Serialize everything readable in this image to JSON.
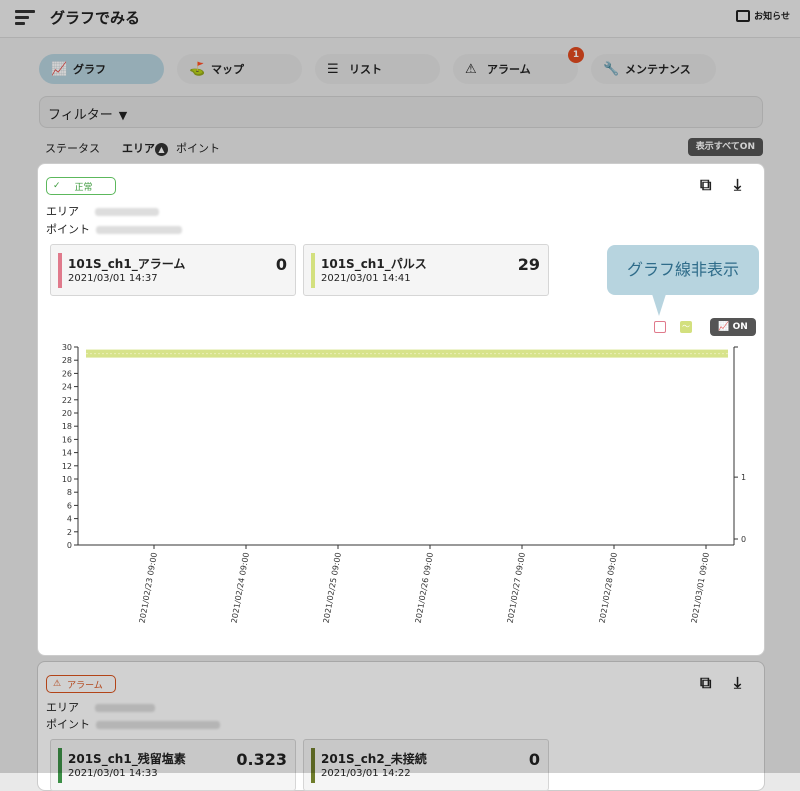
{
  "app": {
    "title": "グラフでみる",
    "notice": "お知らせ"
  },
  "tabs": [
    {
      "label": "グラフ",
      "icon": "chart-icon"
    },
    {
      "label": "マップ",
      "icon": "map-icon"
    },
    {
      "label": "リスト",
      "icon": "list-icon"
    },
    {
      "label": "アラーム",
      "icon": "warning-icon",
      "badge": "1"
    },
    {
      "label": "メンテナンス",
      "icon": "tools-icon"
    }
  ],
  "filter": {
    "label": "フィルター",
    "arrow": "▼"
  },
  "sort": {
    "status": "ステータス",
    "area": "エリア",
    "point": "ポイント",
    "show_all": "表示すべてON"
  },
  "card1": {
    "status": "正常",
    "area_label": "エリア",
    "point_label": "ポイント",
    "sensors": [
      {
        "name": "101S_ch1_アラーム",
        "time": "2021/03/01 14:37",
        "value": "0",
        "color": "#e07a8c"
      },
      {
        "name": "101S_ch1_パルス",
        "time": "2021/03/01 14:41",
        "value": "29",
        "color": "#d3e07e"
      }
    ],
    "tooltip": "グラフ線非表示",
    "on_label": "ON"
  },
  "card2": {
    "status": "アラーム",
    "area_label": "エリア",
    "point_label": "ポイント",
    "sensors": [
      {
        "name": "201S_ch1_残留塩素",
        "time": "2021/03/01 14:33",
        "value": "0.323",
        "color": "#3c8f46"
      },
      {
        "name": "201S_ch2_未接続",
        "time": "2021/03/01 14:22",
        "value": "0",
        "color": "#6f7d2b"
      }
    ]
  },
  "chart_data": {
    "type": "line",
    "x": [
      "2021/02/23 09:00",
      "2021/02/24 09:00",
      "2021/02/25 09:00",
      "2021/02/26 09:00",
      "2021/02/27 09:00",
      "2021/02/28 09:00",
      "2021/03/01 09:00"
    ],
    "ylim": [
      0,
      30
    ],
    "y_ticks": [
      0,
      2,
      4,
      6,
      8,
      10,
      12,
      14,
      16,
      18,
      20,
      22,
      24,
      26,
      28,
      30
    ],
    "y2_ticks": [
      0,
      1
    ],
    "series": [
      {
        "values": [
          29,
          29,
          29,
          29,
          29,
          29,
          29
        ],
        "color": "#d3e07e"
      }
    ]
  }
}
